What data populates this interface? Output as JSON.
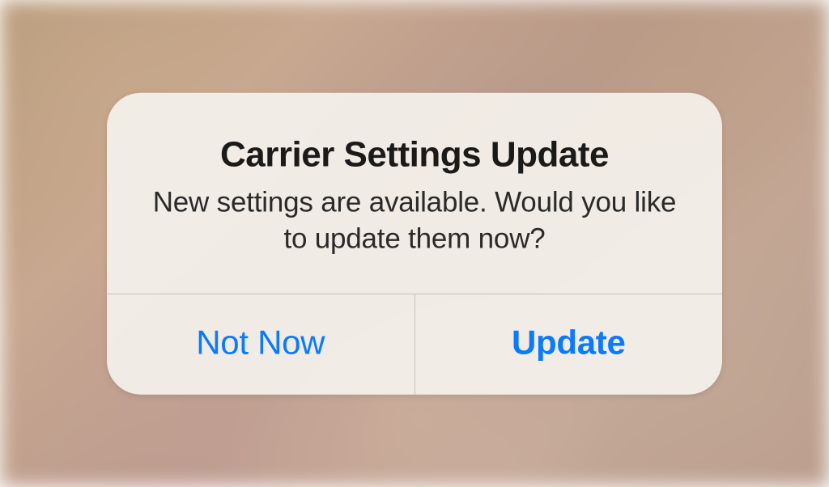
{
  "alert": {
    "title": "Carrier Settings Update",
    "message": "New settings are available. Would you like to update them now?",
    "buttons": {
      "cancel": "Not Now",
      "default": "Update"
    }
  }
}
